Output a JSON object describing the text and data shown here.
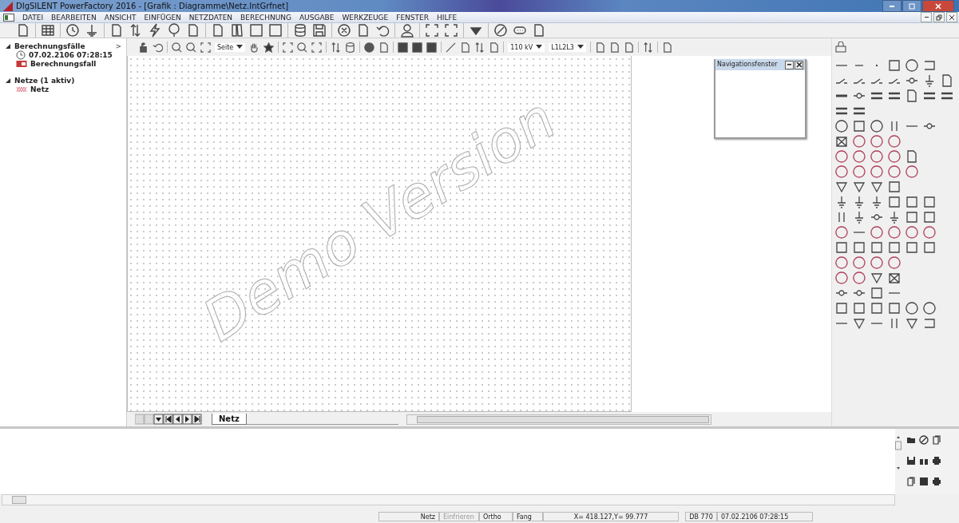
{
  "window": {
    "title": "DIgSILENT PowerFactory 2016 - [Grafik : Diagramme\\Netz.IntGrfnet]"
  },
  "menu": [
    "DATEI",
    "BEARBEITEN",
    "ANSICHT",
    "EINFÜGEN",
    "NETZDATEN",
    "BERECHNUNG",
    "AUSGABE",
    "WERKZEUGE",
    "FENSTER",
    "HILFE"
  ],
  "tree": {
    "collapse": ">",
    "items": [
      {
        "label": "Berechnungsfälle",
        "expanded": true,
        "children": [
          {
            "label": "07.02.2106 07:28:15",
            "kind": "clock"
          },
          {
            "label": "Berechnungsfall",
            "kind": "case"
          }
        ]
      },
      {
        "label": "Netze (1 aktiv)",
        "expanded": true,
        "children": [
          {
            "label": "Netz",
            "kind": "grid"
          }
        ]
      }
    ]
  },
  "graphic_toolbar": {
    "page": "Seite",
    "voltage": "110 kV",
    "phases": "L1L2L3"
  },
  "canvas": {
    "watermark": "Demo Version"
  },
  "navigation_window": {
    "title": "Navigationsfenster"
  },
  "page_tabs": [
    {
      "label": "Netz",
      "selected": true
    }
  ],
  "status_bar": [
    {
      "text": "Netz",
      "disabled": false
    },
    {
      "text": "Einfrieren",
      "disabled": true
    },
    {
      "text": "Ortho",
      "disabled": false
    },
    {
      "text": "Fang",
      "disabled": false
    },
    {
      "text": "X=  418.127,Y=  99.777",
      "disabled": false
    },
    {
      "text": "DB 770",
      "disabled": false
    },
    {
      "text": "07.02.2106 07:28:15",
      "disabled": false
    }
  ]
}
